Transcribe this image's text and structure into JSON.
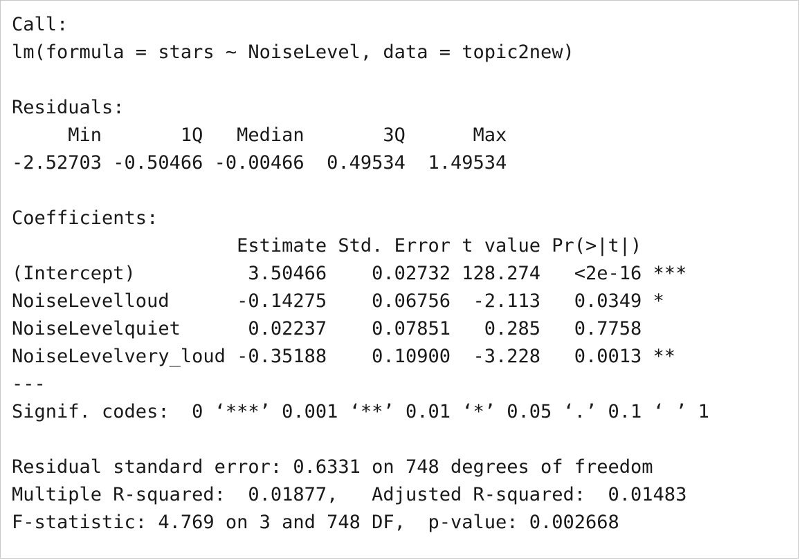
{
  "lines": [
    "Call:",
    "lm(formula = stars ~ NoiseLevel, data = topic2new)",
    "",
    "Residuals:",
    "     Min       1Q   Median       3Q      Max ",
    "-2.52703 -0.50466 -0.00466  0.49534  1.49534 ",
    "",
    "Coefficients:",
    "                    Estimate Std. Error t value Pr(>|t|)    ",
    "(Intercept)          3.50466    0.02732 128.274   <2e-16 ***",
    "NoiseLevelloud      -0.14275    0.06756  -2.113   0.0349 *  ",
    "NoiseLevelquiet      0.02237    0.07851   0.285   0.7758    ",
    "NoiseLevelvery_loud -0.35188    0.10900  -3.228   0.0013 ** ",
    "---",
    "Signif. codes:  0 ‘***’ 0.001 ‘**’ 0.01 ‘*’ 0.05 ‘.’ 0.1 ‘ ’ 1",
    "",
    "Residual standard error: 0.6331 on 748 degrees of freedom",
    "Multiple R-squared:  0.01877,\tAdjusted R-squared:  0.01483 ",
    "F-statistic: 4.769 on 3 and 748 DF,  p-value: 0.002668"
  ]
}
